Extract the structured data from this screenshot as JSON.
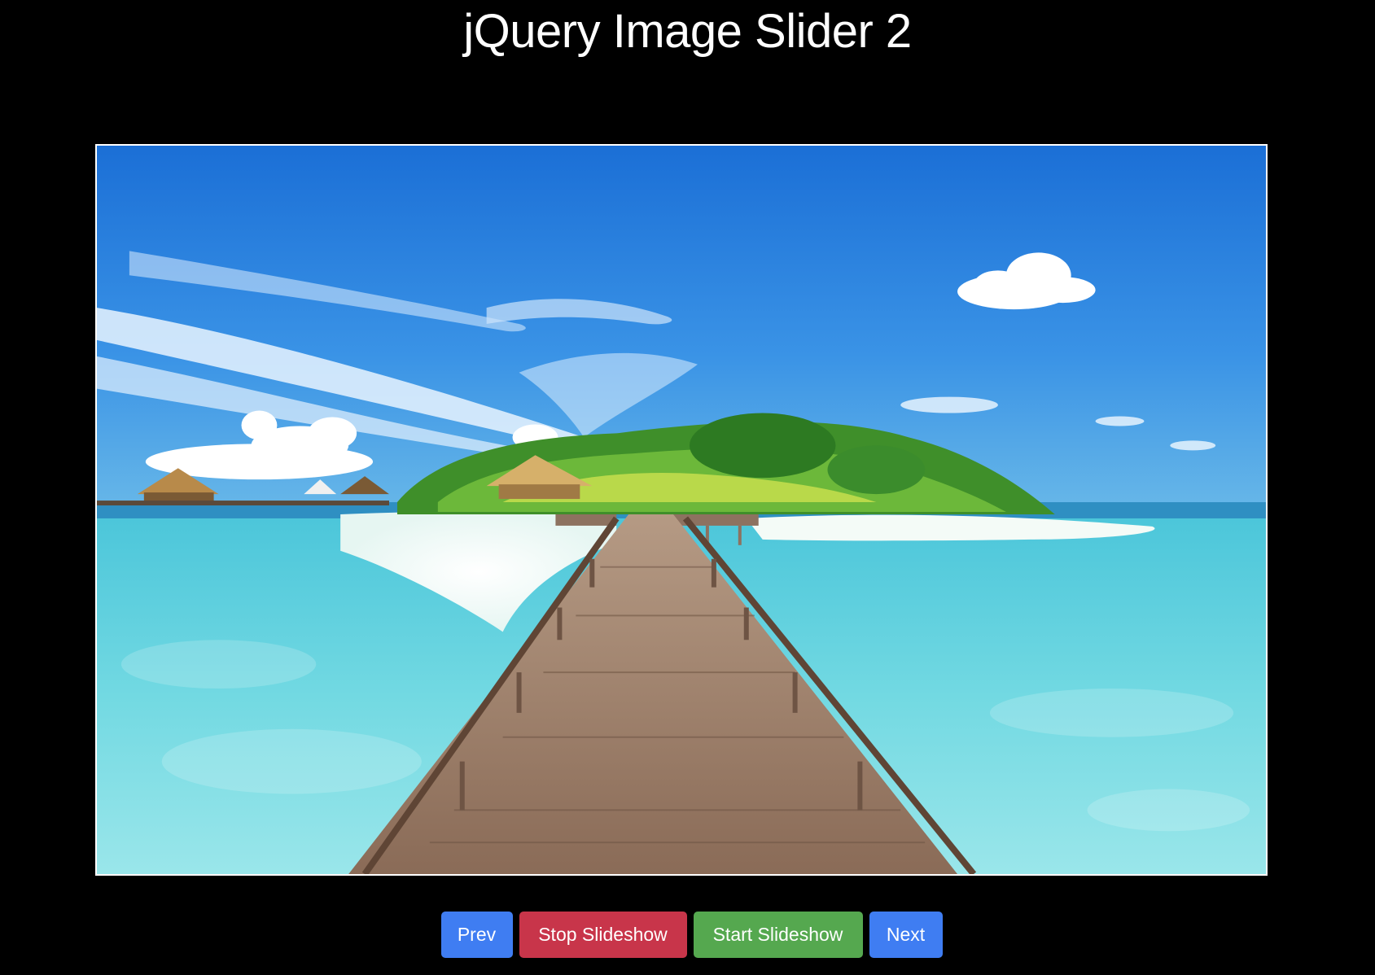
{
  "page": {
    "title": "jQuery Image Slider 2",
    "background": "#000000"
  },
  "slider": {
    "image_alt": "Tropical island with wooden pier over turquoise water",
    "border_color": "#ffffff"
  },
  "controls": {
    "prev_label": "Prev",
    "stop_label": "Stop Slideshow",
    "start_label": "Start Slideshow",
    "next_label": "Next",
    "colors": {
      "prev": "#3f7df2",
      "stop": "#c8354a",
      "start": "#55a84f",
      "next": "#3f7df2"
    }
  }
}
